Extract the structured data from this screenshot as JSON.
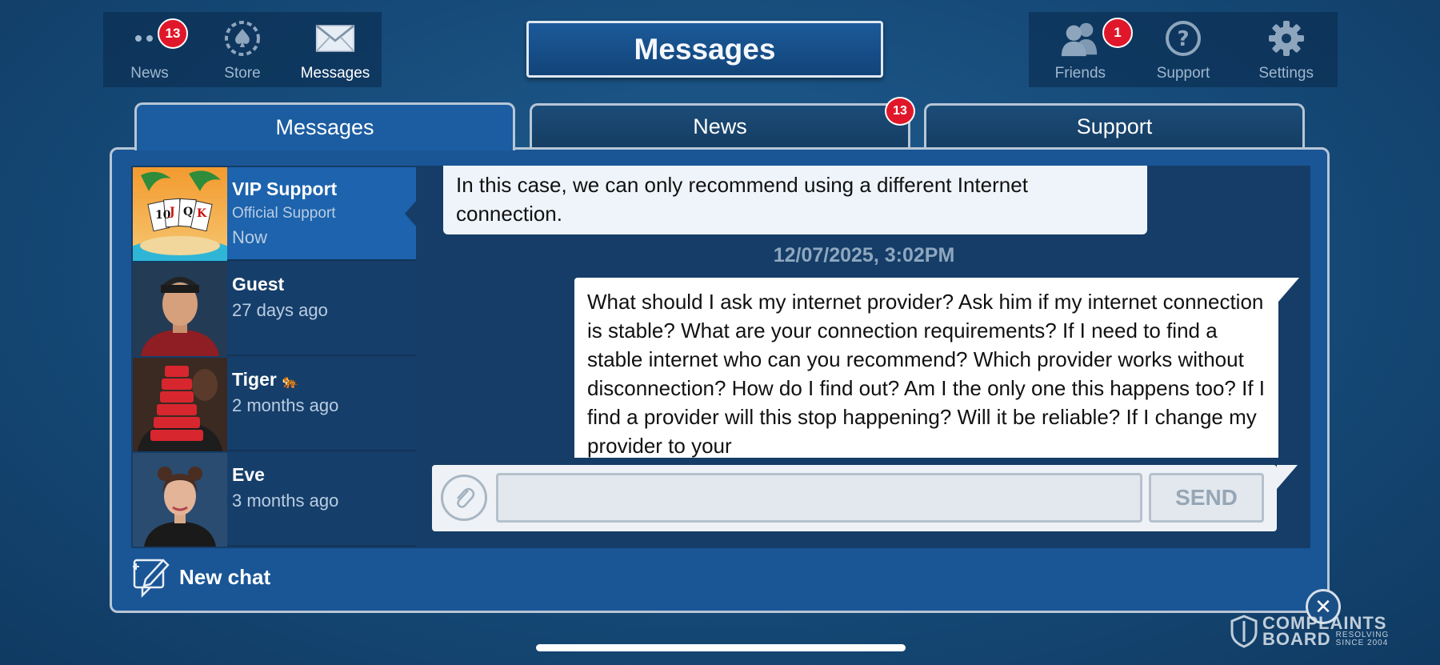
{
  "top_nav_left": [
    {
      "label": "News",
      "icon": "dots-icon",
      "badge": "13"
    },
    {
      "label": "Store",
      "icon": "spade-chip-icon",
      "badge": ""
    },
    {
      "label": "Messages",
      "icon": "envelope-icon",
      "badge": "",
      "active": true
    }
  ],
  "header": {
    "title": "Messages"
  },
  "top_nav_right": [
    {
      "label": "Friends",
      "icon": "friends-icon",
      "badge": "1"
    },
    {
      "label": "Support",
      "icon": "question-icon",
      "badge": ""
    },
    {
      "label": "Settings",
      "icon": "gear-icon",
      "badge": ""
    }
  ],
  "tabs": [
    {
      "label": "Messages",
      "active": true,
      "badge": ""
    },
    {
      "label": "News",
      "active": false,
      "badge": "13"
    },
    {
      "label": "Support",
      "active": false,
      "badge": ""
    }
  ],
  "contacts": [
    {
      "name": "VIP Support",
      "subtitle": "Official Support",
      "time": "Now",
      "selected": true
    },
    {
      "name": "Guest",
      "subtitle": "",
      "time": "27 days ago"
    },
    {
      "name": "Tiger",
      "emoji": "🐅",
      "subtitle": "",
      "time": "2 months ago"
    },
    {
      "name": "Eve",
      "subtitle": "",
      "time": "3 months ago"
    }
  ],
  "chat": {
    "received_text": "In this case, we can only recommend using a different Internet connection.",
    "timestamp": "12/07/2025, 3:02PM",
    "sent_text": "What should I ask my internet provider? Ask him if my internet connection is stable?   What are your connection requirements? If I need to find a stable internet who can you recommend? Which provider works without disconnection? How do I find out? Am I the only one this happens too? If I find a provider will this stop happening? Will it be reliable? If I change my provider to your",
    "input_value": "",
    "send_label": "SEND"
  },
  "new_chat_label": "New chat",
  "close_label": "✕",
  "watermark": {
    "line1": "COMPLAINTS",
    "line2": "BOARD",
    "tag1": "RESOLVING",
    "tag2": "SINCE 2004"
  },
  "colors": {
    "accent": "#1d63ad",
    "badge": "#e0172a",
    "panel": "#1a5596"
  }
}
